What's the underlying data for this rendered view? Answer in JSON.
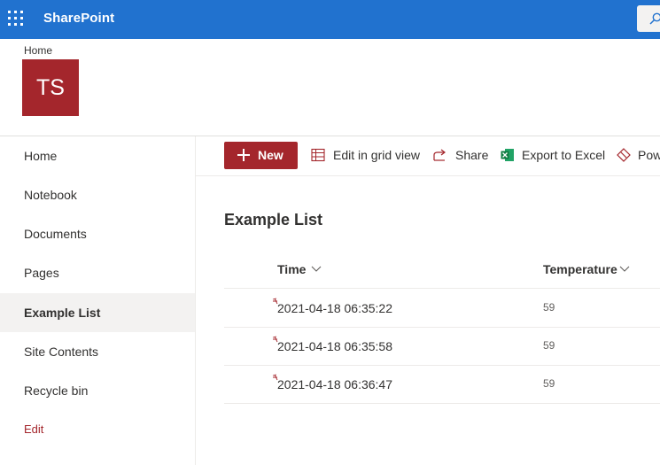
{
  "suite": {
    "brand": "SharePoint",
    "waffle_icon": "app-launcher-icon",
    "search_icon": "search-icon"
  },
  "site": {
    "breadcrumb": "Home",
    "logo_initials": "TS",
    "logo_color": "#a4262c"
  },
  "nav": {
    "items": [
      {
        "label": "Home"
      },
      {
        "label": "Notebook"
      },
      {
        "label": "Documents"
      },
      {
        "label": "Pages"
      },
      {
        "label": "Example List",
        "selected": true
      },
      {
        "label": "Site Contents"
      },
      {
        "label": "Recycle bin"
      }
    ],
    "edit_label": "Edit"
  },
  "commands": {
    "new_label": "New",
    "grid_label": "Edit in grid view",
    "share_label": "Share",
    "export_label": "Export to Excel",
    "power_label": "Pow"
  },
  "list": {
    "title": "Example List",
    "columns": {
      "time": "Time",
      "temperature": "Temperature"
    },
    "rows": [
      {
        "time": "2021-04-18 06:35:22",
        "temperature": "59"
      },
      {
        "time": "2021-04-18 06:35:58",
        "temperature": "59"
      },
      {
        "time": "2021-04-18 06:36:47",
        "temperature": "59"
      }
    ]
  },
  "colors": {
    "suite_bar": "#2172cf",
    "accent": "#a4262c"
  }
}
